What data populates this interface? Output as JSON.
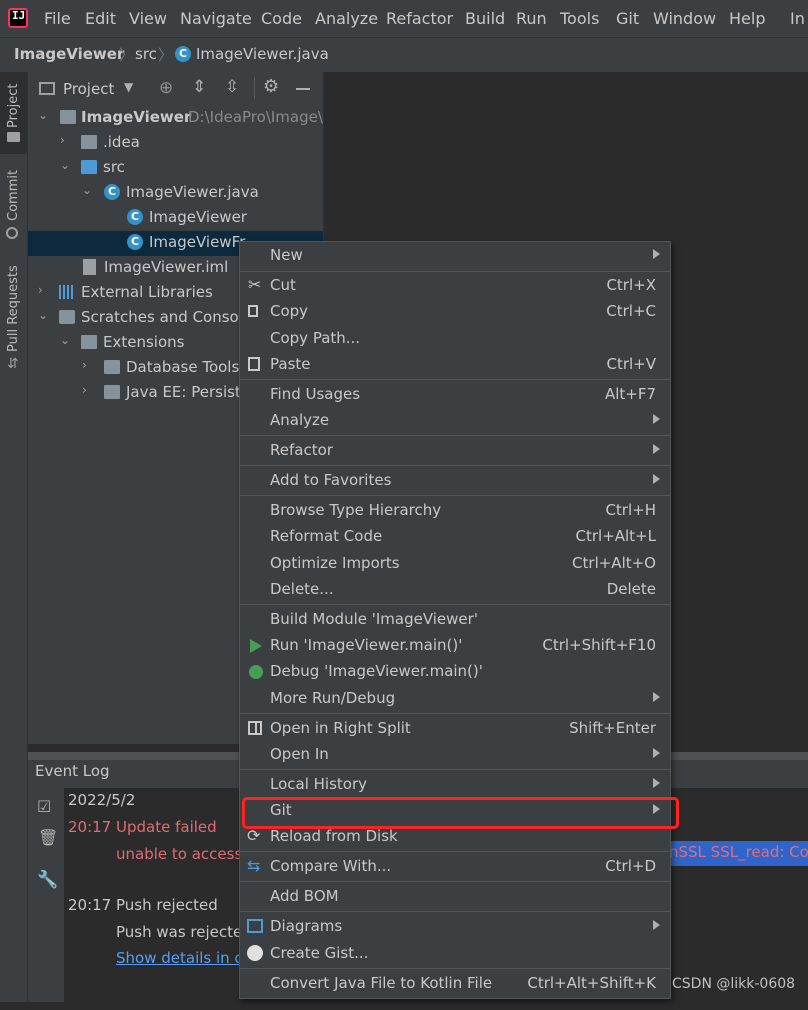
{
  "menubar": {
    "items": [
      "File",
      "Edit",
      "View",
      "Navigate",
      "Code",
      "Analyze",
      "Refactor",
      "Build",
      "Run",
      "Tools",
      "Git",
      "Window",
      "Help"
    ],
    "overflow": "In"
  },
  "navbar": {
    "crumbs": [
      "ImageViewer",
      "src",
      "ImageViewer.java"
    ]
  },
  "toolstrip": {
    "tabs": [
      "Project",
      "Commit",
      "Pull Requests"
    ]
  },
  "project": {
    "title": "Project",
    "tree": {
      "root": "ImageViewer",
      "root_path": "D:\\IdeaPro\\Image\\",
      "idea": ".idea",
      "src": "src",
      "java_file": "ImageViewer.java",
      "class1": "ImageViewer",
      "class2": "ImageViewFr",
      "iml": "ImageViewer.iml",
      "ext_libs": "External Libraries",
      "scratches": "Scratches and Console",
      "extensions": "Extensions",
      "db_tools": "Database Tools",
      "javaee": "Java EE: Persiste"
    }
  },
  "eventlog": {
    "title": "Event Log",
    "date": "2022/5/2",
    "entries": [
      {
        "time": "20:17",
        "text": "Update failed",
        "detail": "unable to access"
      },
      {
        "time": "20:17",
        "text": "Push rejected",
        "detail": "Push was rejecte",
        "link": "Show details in c"
      }
    ],
    "selected_text": "nSSL SSL_read: Conr"
  },
  "context_menu": {
    "items": [
      {
        "label": "New",
        "shortcut": "",
        "submenu": true
      },
      {
        "label": "Cut",
        "shortcut": "Ctrl+X",
        "icon": "scissors-icon"
      },
      {
        "label": "Copy",
        "shortcut": "Ctrl+C",
        "icon": "copy-icon"
      },
      {
        "label": "Copy Path...",
        "shortcut": ""
      },
      {
        "label": "Paste",
        "shortcut": "Ctrl+V",
        "icon": "paste-icon"
      },
      {
        "label": "Find Usages",
        "shortcut": "Alt+F7"
      },
      {
        "label": "Analyze",
        "shortcut": "",
        "submenu": true
      },
      {
        "label": "Refactor",
        "shortcut": "",
        "submenu": true
      },
      {
        "label": "Add to Favorites",
        "shortcut": "",
        "submenu": true
      },
      {
        "label": "Browse Type Hierarchy",
        "shortcut": "Ctrl+H"
      },
      {
        "label": "Reformat Code",
        "shortcut": "Ctrl+Alt+L"
      },
      {
        "label": "Optimize Imports",
        "shortcut": "Ctrl+Alt+O"
      },
      {
        "label": "Delete...",
        "shortcut": "Delete"
      },
      {
        "label": "Build Module 'ImageViewer'",
        "shortcut": ""
      },
      {
        "label": "Run 'ImageViewer.main()'",
        "shortcut": "Ctrl+Shift+F10",
        "icon": "run-icon"
      },
      {
        "label": "Debug 'ImageViewer.main()'",
        "shortcut": "",
        "icon": "debug-icon"
      },
      {
        "label": "More Run/Debug",
        "shortcut": "",
        "submenu": true
      },
      {
        "label": "Open in Right Split",
        "shortcut": "Shift+Enter",
        "icon": "split-icon"
      },
      {
        "label": "Open In",
        "shortcut": "",
        "submenu": true
      },
      {
        "label": "Local History",
        "shortcut": "",
        "submenu": true
      },
      {
        "label": "Git",
        "shortcut": "",
        "submenu": true
      },
      {
        "label": "Reload from Disk",
        "shortcut": "",
        "icon": "reload-icon"
      },
      {
        "label": "Compare With...",
        "shortcut": "Ctrl+D",
        "icon": "compare-icon"
      },
      {
        "label": "Add BOM",
        "shortcut": ""
      },
      {
        "label": "Diagrams",
        "shortcut": "",
        "submenu": true,
        "icon": "diagram-icon"
      },
      {
        "label": "Create Gist...",
        "shortcut": "",
        "icon": "github-icon"
      },
      {
        "label": "Convert Java File to Kotlin File",
        "shortcut": "Ctrl+Alt+Shift+K"
      }
    ]
  },
  "watermark": "CSDN @likk-0608",
  "colors": {
    "accent": "#3592c4",
    "highlight": "#ff2222",
    "error": "#e06c75",
    "link": "#589df6"
  }
}
